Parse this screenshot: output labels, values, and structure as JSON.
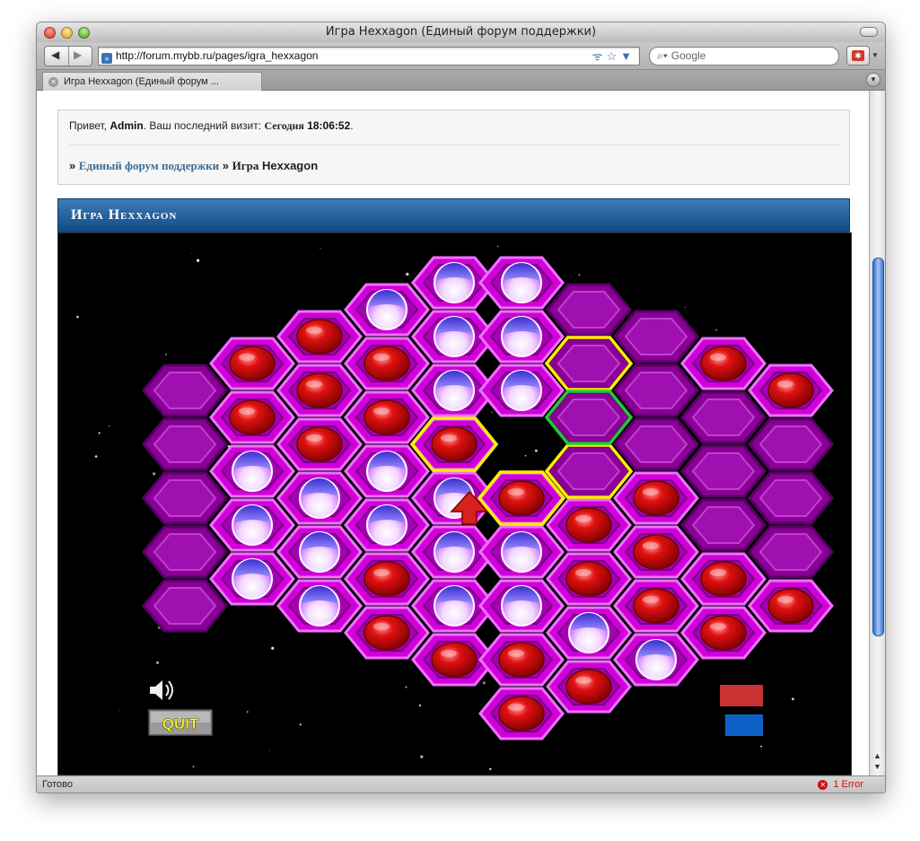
{
  "window": {
    "title": "Игра Hexxagon (Единый форум поддержки)"
  },
  "toolbar": {
    "url": "http://forum.mybb.ru/pages/igra_hexxagon",
    "search_placeholder": "Google"
  },
  "tab": {
    "label": "Игра Hexxagon (Единый форум ..."
  },
  "forum": {
    "greeting_prefix": "Привет,",
    "user": "Admin",
    "last_visit_label": ". Ваш последний визит:",
    "last_visit_day": "Сегодня",
    "last_visit_time": "18:06:52",
    "breadcrumb_sep": "»",
    "breadcrumb_home": "Единый форум поддержки",
    "breadcrumb_current_1": "Игра",
    "breadcrumb_current_2": "Hexxagon"
  },
  "panel": {
    "title": "Игра Hexxagon"
  },
  "game": {
    "quit_label": "QUIT",
    "sound_icon": "speaker-icon",
    "player_colors": {
      "red": "#c83232",
      "blue": "#0d62c8"
    },
    "board": {
      "columns": [
        {
          "col": 0,
          "cells": [
            "empty",
            "empty",
            "empty",
            "empty",
            "empty"
          ]
        },
        {
          "col": 1,
          "cells": [
            "red",
            "red",
            "blue",
            "blue",
            "blue"
          ]
        },
        {
          "col": 2,
          "cells": [
            "red",
            "red",
            "red",
            "blue",
            "blue",
            "blue"
          ]
        },
        {
          "col": 3,
          "cells": [
            "blue",
            "red",
            "red",
            "blue",
            "blue",
            "red",
            "red"
          ]
        },
        {
          "col": 4,
          "cells": [
            "blue",
            "blue",
            "blue",
            "red",
            "blue",
            "blue",
            "blue",
            "red"
          ]
        },
        {
          "col": 5,
          "cells": [
            "blue",
            "blue",
            "blue",
            "empty",
            "red",
            "blue",
            "blue",
            "red",
            "red"
          ]
        },
        {
          "col": 6,
          "cells": [
            "empty",
            "empty",
            "empty",
            "empty",
            "red",
            "red",
            "blue",
            "red"
          ]
        },
        {
          "col": 7,
          "cells": [
            "empty",
            "empty",
            "empty",
            "red",
            "red",
            "red",
            "blue"
          ]
        },
        {
          "col": 8,
          "cells": [
            "red",
            "empty",
            "empty",
            "empty",
            "red",
            "red"
          ]
        },
        {
          "col": 9,
          "cells": [
            "red",
            "empty",
            "empty",
            "empty",
            "red"
          ]
        }
      ]
    }
  },
  "status": {
    "text": "Готово",
    "error": "1 Error"
  }
}
